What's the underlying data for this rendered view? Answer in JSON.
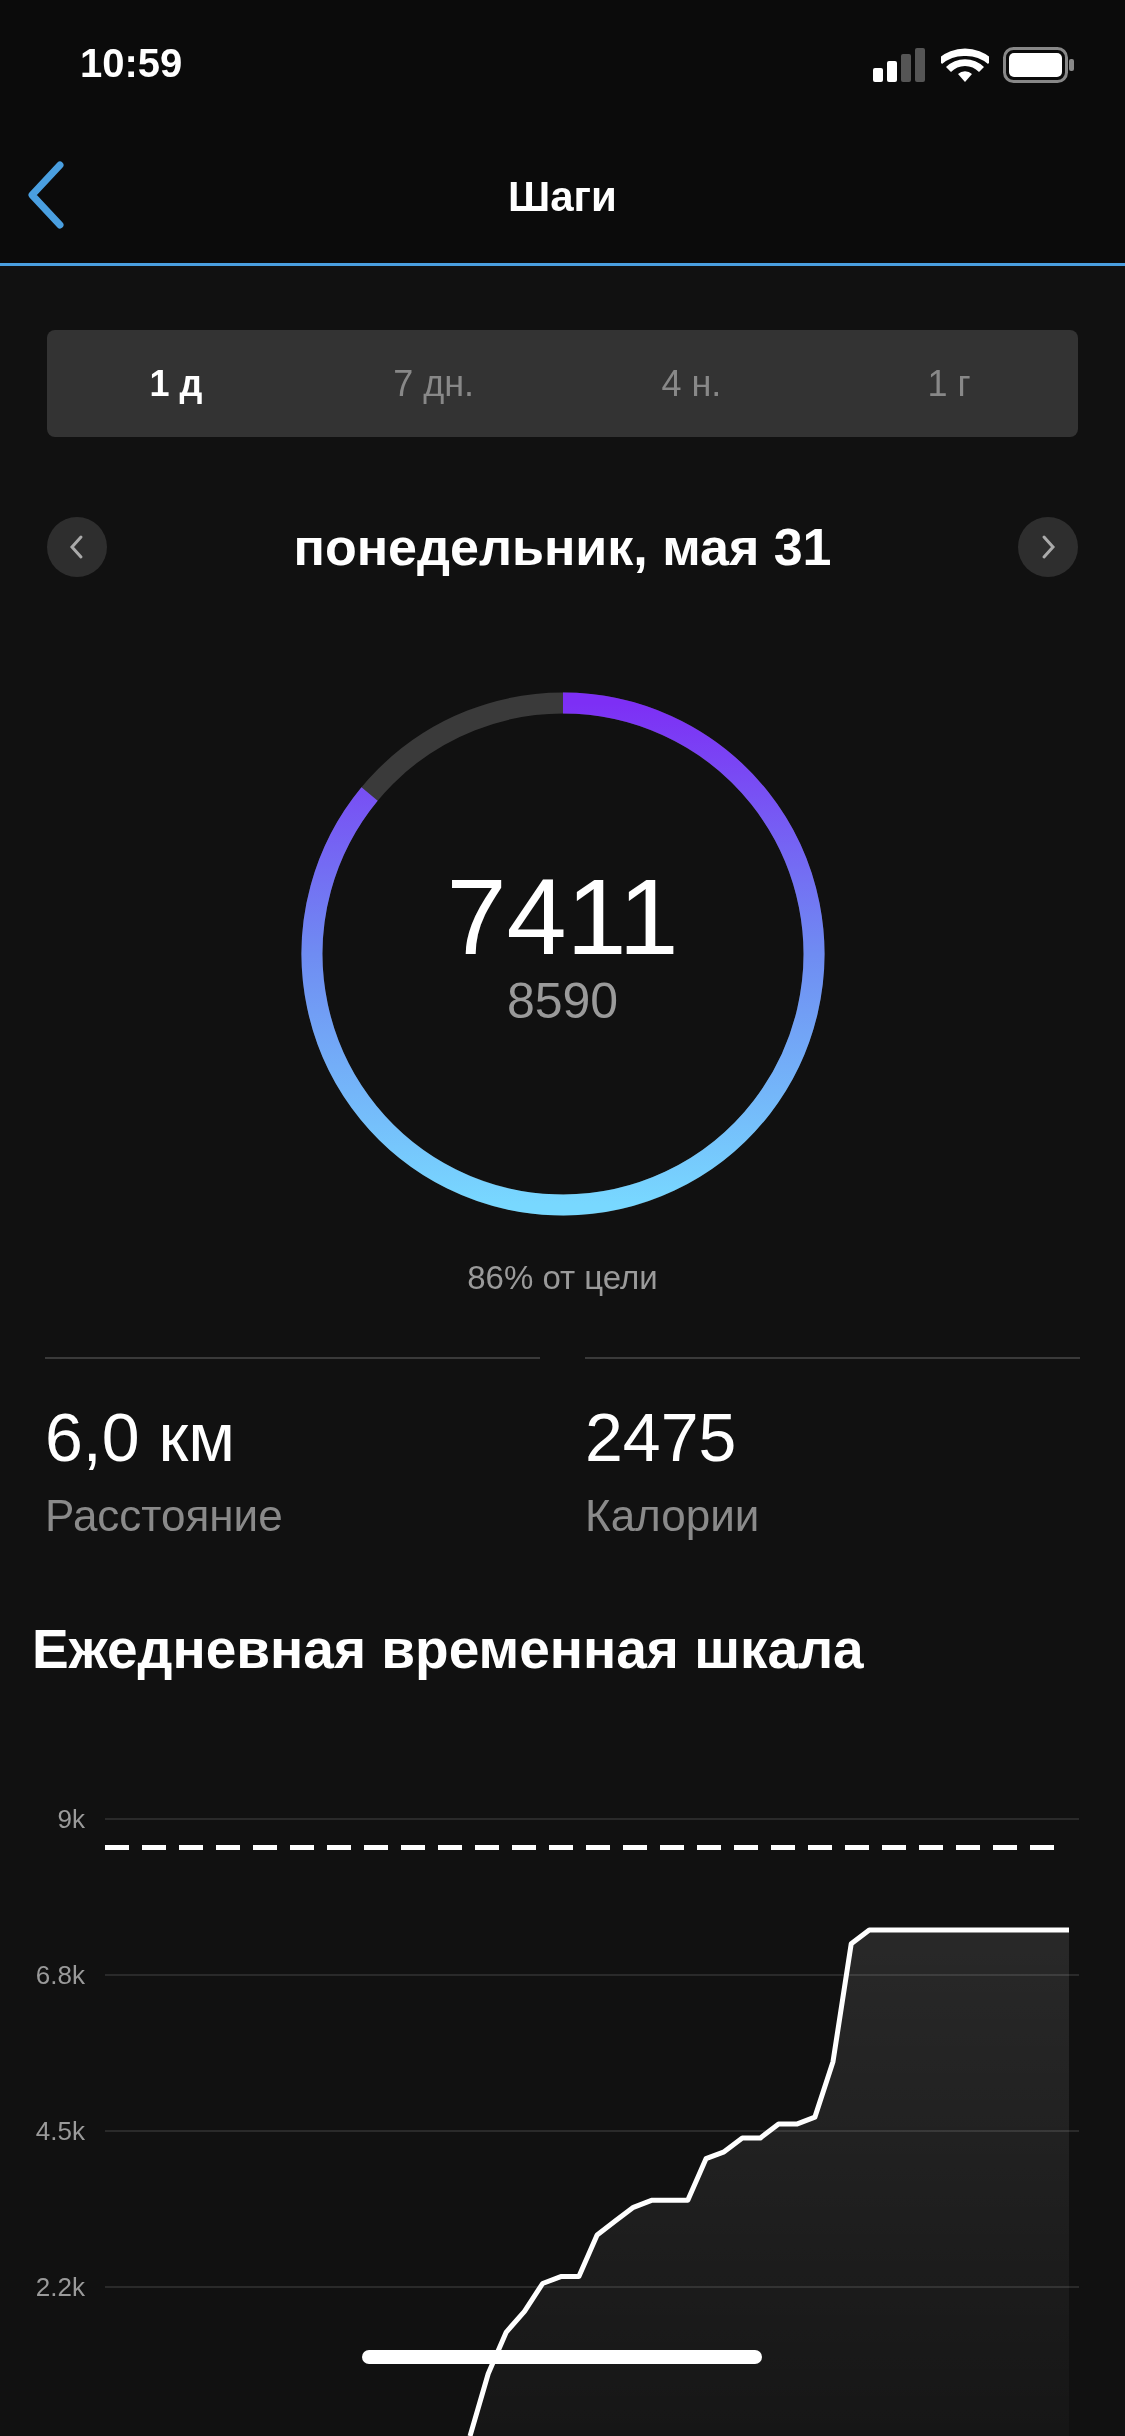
{
  "status_bar": {
    "time": "10:59"
  },
  "header": {
    "title": "Шаги"
  },
  "tabs": [
    {
      "label": "1 д",
      "selected": true
    },
    {
      "label": "7 дн.",
      "selected": false
    },
    {
      "label": "4 н.",
      "selected": false
    },
    {
      "label": "1 г",
      "selected": false
    }
  ],
  "date": "понедельник, мая 31",
  "ring": {
    "steps": "7411",
    "goal": "8590",
    "caption": "86% от цели"
  },
  "stats": [
    {
      "value": "6,0 км",
      "label": "Расстояние"
    },
    {
      "value": "2475",
      "label": "Калории"
    }
  ],
  "timeline": {
    "title": "Ежедневная временная шкала",
    "chart_data": {
      "type": "area",
      "ylim": [
        0,
        9000
      ],
      "yticks": [
        {
          "value": 2250,
          "label": "2.2k"
        },
        {
          "value": 4500,
          "label": "4.5k"
        },
        {
          "value": 6750,
          "label": "6.8k"
        },
        {
          "value": 9000,
          "label": "9k"
        }
      ],
      "categories": [
        null,
        null,
        null,
        null,
        null,
        null,
        null,
        null,
        null,
        null,
        null,
        null,
        null,
        null,
        null,
        null,
        null,
        null,
        null,
        null,
        null,
        null,
        null,
        null,
        null,
        null,
        null,
        null,
        null,
        null,
        null,
        null,
        null,
        null
      ],
      "grid": true,
      "series": [
        {
          "color": "#ffffff",
          "values": [
            100,
            1000,
            1600,
            1900,
            2300,
            2400,
            2400,
            3000,
            3200,
            3400,
            3500,
            3500,
            3500,
            4100,
            4200,
            4400,
            4400,
            4600,
            4600,
            4700,
            5500,
            7200,
            7400,
            7400,
            7400,
            7400,
            7400,
            7400,
            7400,
            7400,
            7400,
            7400,
            7400,
            7400
          ]
        }
      ],
      "ref_lines": [
        {
          "axis": "y",
          "value": 8590
        }
      ]
    }
  }
}
